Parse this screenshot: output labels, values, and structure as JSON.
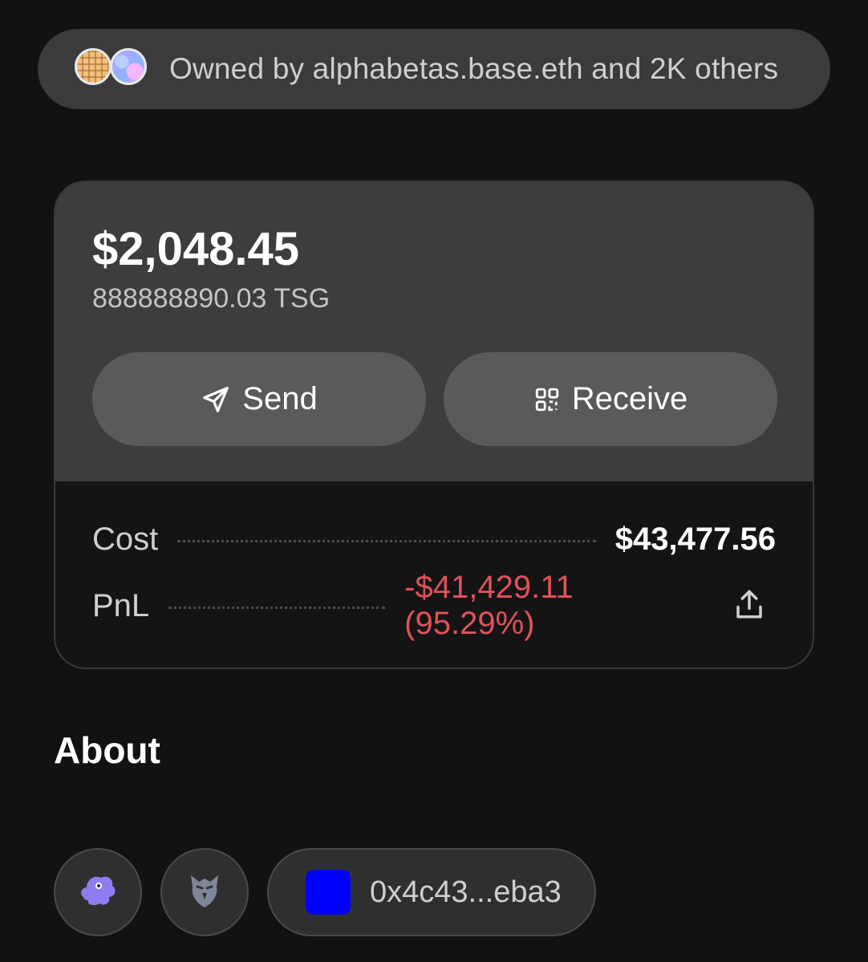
{
  "owners": {
    "text": "Owned by alphabetas.base.eth and 2K others",
    "avatars": [
      "waffle-avatar",
      "iridescent-avatar"
    ]
  },
  "balance": {
    "usd": "$2,048.45",
    "token": "888888890.03 TSG"
  },
  "actions": {
    "send_label": "Send",
    "receive_label": "Receive"
  },
  "stats": {
    "cost_label": "Cost",
    "cost_value": "$43,477.56",
    "pnl_label": "PnL",
    "pnl_value": "-$41,429.11 (95.29%)"
  },
  "colors": {
    "negative": "#e0525a",
    "contract_swatch": "#0000ff"
  },
  "about": {
    "heading": "About",
    "links": [
      "purple-creature-icon",
      "eagle-icon"
    ],
    "contract": "0x4c43...eba3"
  }
}
